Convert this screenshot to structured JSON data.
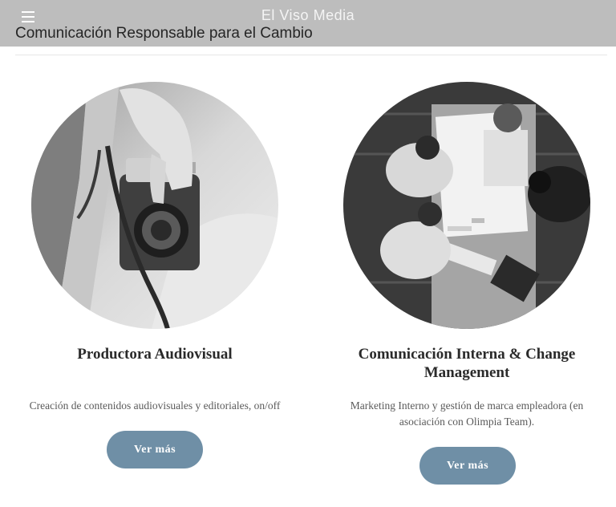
{
  "header": {
    "brand": "El Viso Media",
    "tagline": "Comunicación Responsable para el Cambio",
    "menu_icon": "hamburger-menu-icon"
  },
  "cards": [
    {
      "image": "camera-hand-photo",
      "title": "Productora Audiovisual",
      "description": "Creación de contenidos audiovisuales y editoriales, on/off",
      "button_label": "Ver más"
    },
    {
      "image": "team-meeting-overhead-photo",
      "title": "Comunicación Interna & Change Management",
      "description": "Marketing Interno y  gestión de marca empleadora (en asociación con Olimpia Team).",
      "button_label": "Ver más"
    }
  ],
  "colors": {
    "header_bg": "#bdbdbd",
    "button_bg": "#6f8fa6"
  }
}
